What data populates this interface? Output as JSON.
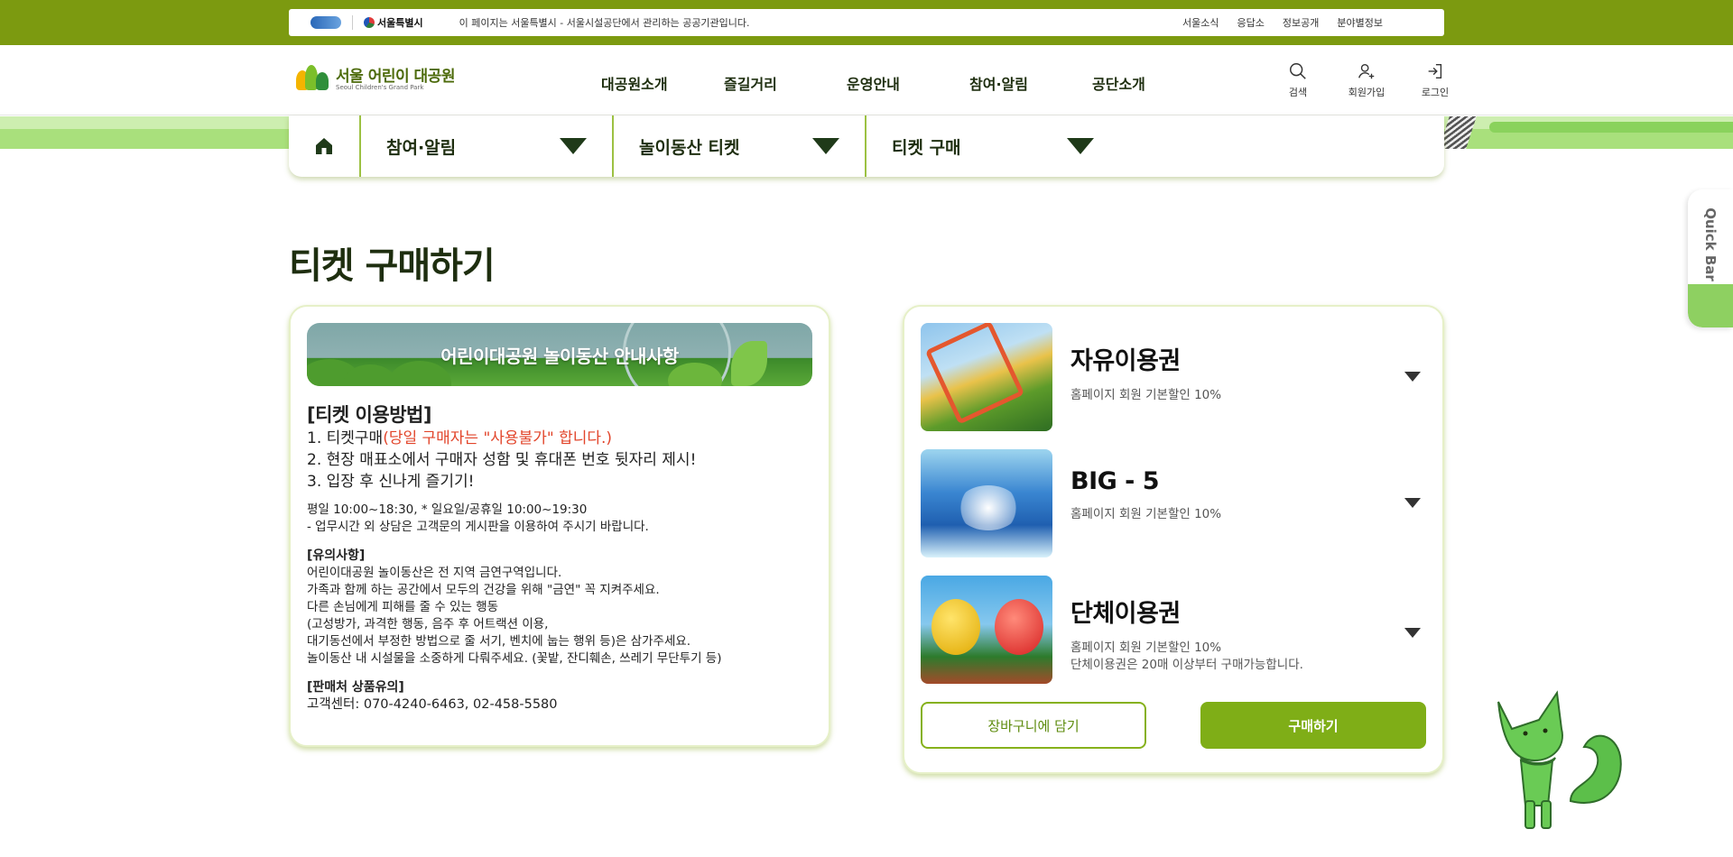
{
  "topbar": {
    "gov_logo_text": "서울특별시",
    "notice": "이 페이지는 서울특별시 - 서울시설공단에서 관리하는 공공기관입니다.",
    "links": [
      "서울소식",
      "응답소",
      "정보공개",
      "분야별정보"
    ]
  },
  "header": {
    "brand_kr": "서울 어린이 대공원",
    "brand_en": "Seoul Children's Grand Park",
    "nav": [
      "대공원소개",
      "즐길거리",
      "운영안내",
      "참여·알림",
      "공단소개"
    ],
    "util": {
      "search": "검색",
      "signup": "회원가입",
      "login": "로그인"
    }
  },
  "subnav": {
    "items": [
      "참여·알림",
      "놀이동산 티켓",
      "티켓 구매"
    ]
  },
  "page_title": "티켓 구매하기",
  "guide": {
    "banner": "어린이대공원 놀이동산 안내사항",
    "heading": "[티켓 이용방법]",
    "step1_prefix": "1. 티켓구매",
    "step1_red": "(당일 구매자는 \"사용불가\" 합니다.)",
    "step2": "2. 현장 매표소에서 구매자 성함 및 휴대폰 번호 뒷자리 제시!",
    "step3": "3. 입장 후 신나게 즐기기!",
    "hours": "평일 10:00~18:30, * 일요일/공휴일 10:00~19:30",
    "hours_note": "- 업무시간 외 상담은 고객문의 게시판을 이용하여 주시기 바랍니다.",
    "caution_title": "[유의사항]",
    "caution_lines": [
      "어린이대공원 놀이동산은 전 지역 금연구역입니다.",
      "가족과 함께 하는 공간에서 모두의 건강을 위해 \"금연\" 꼭 지켜주세요.",
      "다른 손님에게 피해를 줄 수 있는 행동",
      "(고성방가, 과격한 행동, 음주 후 어트랙션 이용,",
      "대기동선에서 부정한 방법으로 줄 서기, 벤치에 눕는 행위 등)은 삼가주세요.",
      "놀이동산 내 시설물을 소중하게 다뤄주세요. (꽃밭, 잔디훼손, 쓰레기 무단투기 등)"
    ],
    "seller_title": "[판매처 상품유의]",
    "seller_contact": "고객센터: 070-4240-6463, 02-458-5580"
  },
  "tickets": [
    {
      "name": "자유이용권",
      "desc1": "홈페이지 회원 기본할인 10%",
      "desc2": ""
    },
    {
      "name": "BIG - 5",
      "desc1": "홈페이지 회원 기본할인 10%",
      "desc2": ""
    },
    {
      "name": "단체이용권",
      "desc1": "홈페이지 회원 기본할인 10%",
      "desc2": "단체이용권은 20매 이상부터 구매가능합니다."
    }
  ],
  "actions": {
    "cart": "장바구니에 담기",
    "buy": "구매하기"
  },
  "quickbar": {
    "label": "Quick Bar"
  },
  "colors": {
    "brand_green": "#7c9a10",
    "button_green": "#7fae17",
    "notice_red": "#e2452b"
  }
}
